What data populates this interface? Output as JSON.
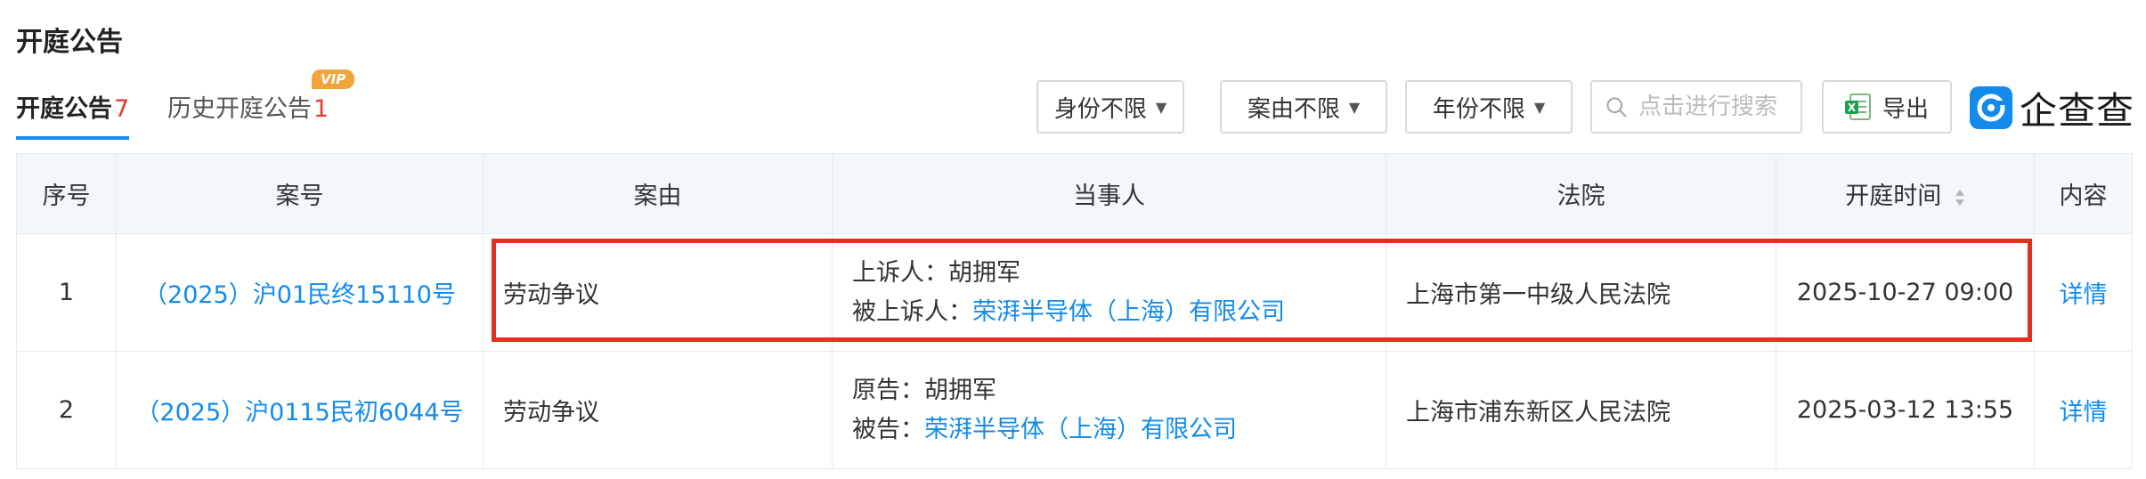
{
  "page": {
    "title": "开庭公告"
  },
  "tabs": [
    {
      "label": "开庭公告",
      "count": "7",
      "active": true
    },
    {
      "label": "历史开庭公告",
      "count": "1",
      "badge": "VIP",
      "active": false
    }
  ],
  "filters": {
    "identity": "身份不限",
    "cause": "案由不限",
    "year": "年份不限",
    "search_placeholder": "点击进行搜索",
    "export_label": "导出"
  },
  "logo": {
    "text": "企查查"
  },
  "table": {
    "headers": {
      "index": "序号",
      "case_no": "案号",
      "cause": "案由",
      "parties": "当事人",
      "court": "法院",
      "time": "开庭时间",
      "content": "内容"
    },
    "rows": [
      {
        "index": "1",
        "case_no": "（2025）沪01民终15110号",
        "cause": "劳动争议",
        "party1_role": "上诉人：",
        "party1_name": "胡拥军",
        "party2_role": "被上诉人：",
        "party2_name": "荣湃半导体（上海）有限公司",
        "court": "上海市第一中级人民法院",
        "time": "2025-10-27 09:00",
        "detail": "详情"
      },
      {
        "index": "2",
        "case_no": "（2025）沪0115民初6044号",
        "cause": "劳动争议",
        "party1_role": "原告：",
        "party1_name": "胡拥军",
        "party2_role": "被告：",
        "party2_name": "荣湃半导体（上海）有限公司",
        "court": "上海市浦东新区人民法院",
        "time": "2025-03-12 13:55",
        "detail": "详情"
      }
    ]
  },
  "colors": {
    "accent": "#128bed",
    "count_red": "#e23b2e",
    "vip": "#f0a43c",
    "highlight": "#e2311f"
  }
}
